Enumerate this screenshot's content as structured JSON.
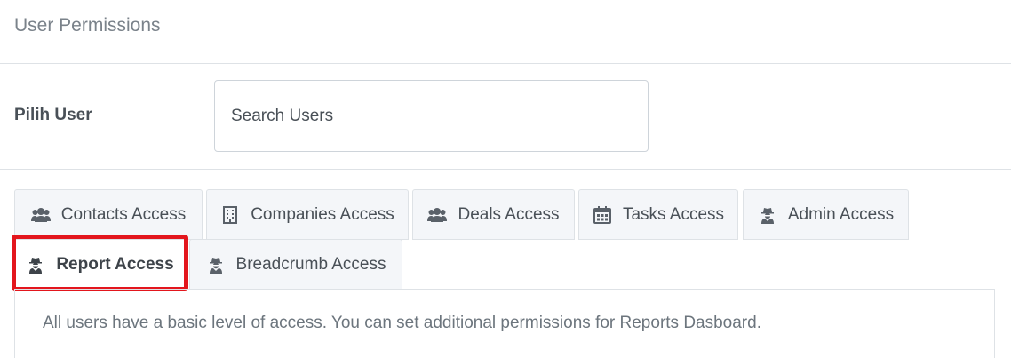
{
  "header": {
    "title": "User Permissions"
  },
  "user_select": {
    "label": "Pilih User",
    "placeholder": "Search Users"
  },
  "tabs": [
    {
      "label": "Contacts Access",
      "icon": "users-icon",
      "active": false
    },
    {
      "label": "Companies Access",
      "icon": "building-icon",
      "active": false
    },
    {
      "label": "Deals Access",
      "icon": "users-icon",
      "active": false
    },
    {
      "label": "Tasks Access",
      "icon": "calendar-icon",
      "active": false
    },
    {
      "label": "Admin Access",
      "icon": "user-secret-icon",
      "active": false
    },
    {
      "label": "Report Access",
      "icon": "user-secret-icon",
      "active": true
    },
    {
      "label": "Breadcrumb Access",
      "icon": "user-secret-icon",
      "active": false
    }
  ],
  "tab_content": {
    "text": "All users have a basic level of access. You can set additional permissions for Reports Dasboard."
  },
  "colors": {
    "highlight": "#e3161d",
    "tab_bg": "#f4f6f9",
    "border": "#dee2e6"
  }
}
